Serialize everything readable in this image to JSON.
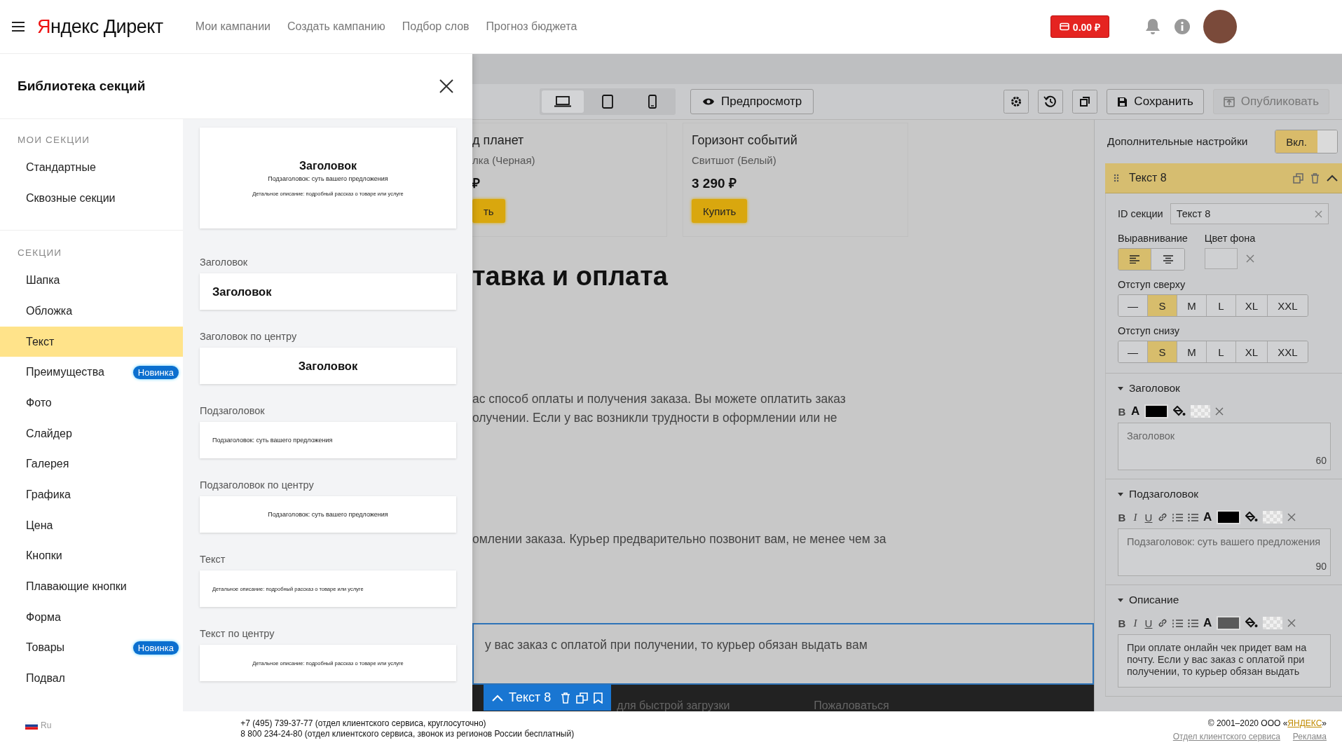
{
  "header": {
    "logo": "Яндекс Директ",
    "nav": [
      "Мои кампании",
      "Создать кампанию",
      "Подбор слов",
      "Прогноз бюджета"
    ],
    "balance": "0.00 ₽"
  },
  "library": {
    "title": "Библиотека секций",
    "groups": [
      {
        "heading": "МОИ СЕКЦИИ",
        "items": [
          {
            "label": "Стандартные",
            "selected": false
          },
          {
            "label": "Сквозные секции",
            "selected": false
          }
        ]
      },
      {
        "heading": "СЕКЦИИ",
        "items": [
          {
            "label": "Шапка",
            "selected": false
          },
          {
            "label": "Обложка",
            "selected": false
          },
          {
            "label": "Текст",
            "selected": true
          },
          {
            "label": "Преимущества",
            "selected": false,
            "badge": "Новинка"
          },
          {
            "label": "Фото",
            "selected": false
          },
          {
            "label": "Слайдер",
            "selected": false
          },
          {
            "label": "Галерея",
            "selected": false
          },
          {
            "label": "Графика",
            "selected": false
          },
          {
            "label": "Цена",
            "selected": false
          },
          {
            "label": "Кнопки",
            "selected": false
          },
          {
            "label": "Плавающие кнопки",
            "selected": false
          },
          {
            "label": "Форма",
            "selected": false
          },
          {
            "label": "Товары",
            "selected": false,
            "badge": "Новинка"
          },
          {
            "label": "Подвал",
            "selected": false
          }
        ]
      }
    ],
    "templates": [
      {
        "centered": true,
        "lines": [
          {
            "kind": "title",
            "text": "Заголовок"
          },
          {
            "kind": "subtitle",
            "text": "Подзаголовок: суть вашего предложения"
          },
          {
            "kind": "text",
            "text": "Детальное описание: подробный рассказ о товаре или услуге"
          }
        ]
      },
      {
        "label": "Заголовок",
        "centered": false,
        "lines": [
          {
            "kind": "title",
            "text": "Заголовок"
          }
        ]
      },
      {
        "label": "Заголовок по центру",
        "centered": true,
        "lines": [
          {
            "kind": "title",
            "text": "Заголовок"
          }
        ]
      },
      {
        "label": "Подзаголовок",
        "centered": false,
        "lines": [
          {
            "kind": "subtitle",
            "text": "Подзаголовок: суть вашего предложения"
          }
        ]
      },
      {
        "label": "Подзаголовок по центру",
        "centered": true,
        "lines": [
          {
            "kind": "subtitle",
            "text": "Подзаголовок: суть вашего предложения"
          }
        ]
      },
      {
        "label": "Текст",
        "centered": false,
        "lines": [
          {
            "kind": "text",
            "text": "Детальное описание: подробный рассказ о товаре или услуге"
          }
        ]
      },
      {
        "label": "Текст по центру",
        "centered": true,
        "lines": [
          {
            "kind": "text",
            "text": "Детальное описание: подробный рассказ о товаре или услуге"
          }
        ]
      }
    ]
  },
  "editor": {
    "devices": [
      {
        "kind": "laptop",
        "selected": true
      },
      {
        "kind": "tablet",
        "selected": false
      },
      {
        "kind": "phone",
        "selected": false
      }
    ],
    "preview": "Предпросмотр",
    "save": "Сохранить",
    "publish": {
      "label": "Опубликовать",
      "disabled": true
    },
    "products": [
      {
        "title": "д планет",
        "subtitle": "лка (Черная)",
        "price": "₽",
        "button": "ть"
      },
      {
        "title": "Горизонт событий",
        "subtitle": "Свитшот (Белый)",
        "price": "3 290 ₽",
        "button": "Купить"
      }
    ],
    "heading": "тавка и оплата",
    "paragraphs": [
      [
        "ас способ оплаты и получения заказа. Вы можете оплатить заказ",
        "олучении. Если у вас возникли трудности в оформлении или не"
      ],
      [
        "омлении заказа. Курьер предварительно позвонит вам, не менее чем за"
      ]
    ],
    "selected_block": "у вас заказ с оплатой при получении, то курьер обязан выдать вам",
    "section_tag": "Текст 8",
    "footer_texts": [
      "для быстрой загрузки",
      "Пожаловаться"
    ]
  },
  "settings": {
    "extra_label": "Дополнительные настройки",
    "toggle": {
      "label": "Вкл.",
      "on": true
    },
    "section": {
      "title": "Текст 8",
      "expanded": true,
      "id_label": "ID секции",
      "id_value": "Текст 8",
      "align_label": "Выравнивание",
      "align": [
        {
          "kind": "left",
          "selected": true
        },
        {
          "kind": "center",
          "selected": false
        }
      ],
      "bg_label": "Цвет фона",
      "spacing": [
        {
          "label": "Отступ сверху",
          "options": [
            {
              "label": "—",
              "selected": false
            },
            {
              "label": "S",
              "selected": true
            },
            {
              "label": "M",
              "selected": false
            },
            {
              "label": "L",
              "selected": false
            },
            {
              "label": "XL",
              "selected": false
            },
            {
              "label": "XXL",
              "selected": false
            }
          ]
        },
        {
          "label": "Отступ снизу",
          "options": [
            {
              "label": "—",
              "selected": false
            },
            {
              "label": "S",
              "selected": true
            },
            {
              "label": "M",
              "selected": false
            },
            {
              "label": "L",
              "selected": false
            },
            {
              "label": "XL",
              "selected": false
            },
            {
              "label": "XXL",
              "selected": false
            }
          ]
        }
      ]
    },
    "fields": [
      {
        "title": "Заголовок",
        "expanded": true,
        "tools": [
          {
            "kind": "bold",
            "glyph": "B"
          },
          {
            "kind": "color",
            "glyph": "A"
          }
        ],
        "color": "#000000",
        "placeholder": "Заголовок",
        "count": "60"
      },
      {
        "title": "Подзаголовок",
        "expanded": true,
        "tools": [
          {
            "kind": "bold",
            "glyph": "B"
          },
          {
            "kind": "italic",
            "glyph": "I"
          },
          {
            "kind": "underline",
            "glyph": "U"
          },
          {
            "kind": "link"
          },
          {
            "kind": "ol"
          },
          {
            "kind": "ul"
          },
          {
            "kind": "color",
            "glyph": "A"
          }
        ],
        "color": "#000000",
        "placeholder": "Подзаголовок: суть вашего предложения",
        "count": "90"
      },
      {
        "title": "Описание",
        "expanded": true,
        "tools": [
          {
            "kind": "bold",
            "glyph": "B"
          },
          {
            "kind": "italic",
            "glyph": "I"
          },
          {
            "kind": "underline",
            "glyph": "U"
          },
          {
            "kind": "link"
          },
          {
            "kind": "ol"
          },
          {
            "kind": "ul"
          },
          {
            "kind": "color",
            "glyph": "A"
          }
        ],
        "color": "#5a5a5a",
        "value": "При оплате онлайн чек придет вам на почту. Если у вас заказ с оплатой при получении, то курьер обязан выдать"
      }
    ]
  },
  "footer": {
    "locale": "Ru",
    "phones": [
      "+7 (495) 739-37-77 (отдел клиентского сервиса, круглосуточно)",
      "8 800 234-24-80 (отдел клиентского сервиса, звонок из регионов России бесплатный)"
    ],
    "copyright": {
      "prefix": "© 2001–2020 ООО «",
      "link": "ЯНДЕКС",
      "suffix": "»"
    },
    "links": [
      "Отдел клиентского сервиса",
      "Реклама"
    ]
  }
}
